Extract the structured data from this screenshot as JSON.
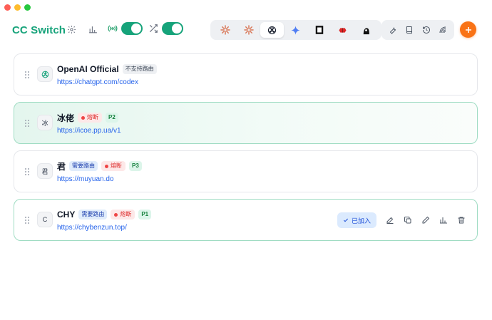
{
  "header": {
    "title": "CC Switch"
  },
  "providers": [
    {
      "name": "OpenAI Official",
      "avatar_text": "",
      "url": "https://chatgpt.com/codex",
      "route_badge": "不支持路由"
    },
    {
      "name": "冰佬",
      "avatar_text": "冰",
      "url": "https://icoe.pp.ua/v1",
      "status_badge": "熔断",
      "priority": "P2"
    },
    {
      "name": "君",
      "avatar_text": "君",
      "url": "https://muyuan.do",
      "route_badge": "需要路由",
      "status_badge": "熔断",
      "priority": "P3"
    },
    {
      "name": "CHY",
      "avatar_text": "C",
      "url": "https://chybenzun.top/",
      "route_badge": "需要路由",
      "status_badge": "熔断",
      "priority": "P1",
      "joined_label": "已加入"
    }
  ],
  "colors": {
    "brand": "#16a37a",
    "add_button": "#f97316",
    "link": "#2563eb",
    "fail_badge": "#dc2626"
  }
}
